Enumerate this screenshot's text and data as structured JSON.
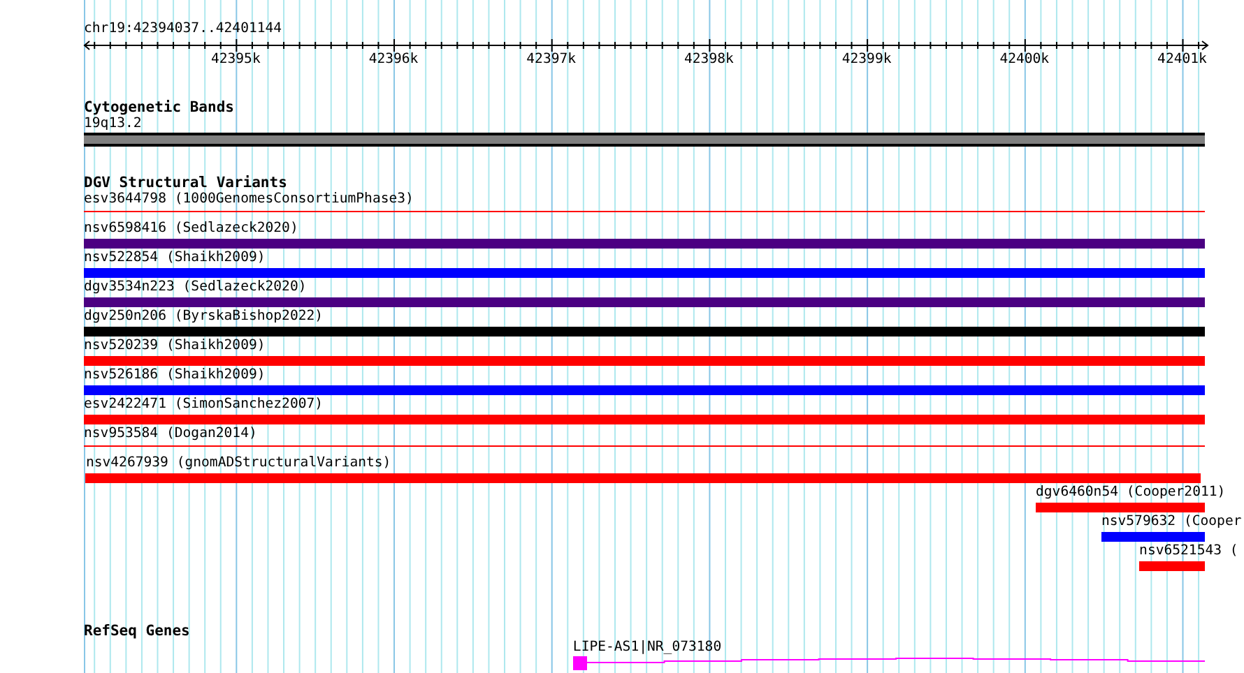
{
  "region": {
    "label": "chr19:42394037..42401144"
  },
  "ruler": {
    "ticks": [
      {
        "label": "42395k"
      },
      {
        "label": "42396k"
      },
      {
        "label": "42397k"
      },
      {
        "label": "42398k"
      },
      {
        "label": "42399k"
      },
      {
        "label": "42400k"
      },
      {
        "label": "42401k"
      }
    ]
  },
  "tracks": [
    {
      "kind": "cytoband",
      "title": "Cytogenetic Bands",
      "features": [
        {
          "label": "19q13.2",
          "color": "#808080"
        }
      ]
    },
    {
      "kind": "variants",
      "title": "DGV Structural Variants",
      "features": [
        {
          "label": "esv3644798 (1000GenomesConsortiumPhase3)",
          "kind": "thin",
          "color": "#ff0000"
        },
        {
          "label": "nsv6598416 (Sedlazeck2020)",
          "kind": "bar",
          "color": "#4b0082"
        },
        {
          "label": "nsv522854 (Shaikh2009)",
          "kind": "bar",
          "color": "#0000ff"
        },
        {
          "label": "dgv3534n223 (Sedlazeck2020)",
          "kind": "bar",
          "color": "#4b0082"
        },
        {
          "label": "dgv250n206 (ByrskaBishop2022)",
          "kind": "bar",
          "color": "#000000"
        },
        {
          "label": "nsv520239 (Shaikh2009)",
          "kind": "bar",
          "color": "#ff0000"
        },
        {
          "label": "nsv526186 (Shaikh2009)",
          "kind": "bar",
          "color": "#0000ff"
        },
        {
          "label": "esv2422471 (SimonSanchez2007)",
          "kind": "bar",
          "color": "#ff0000"
        },
        {
          "label": "nsv953584 (Dogan2014)",
          "kind": "thin",
          "color": "#ff0000"
        },
        {
          "label": "nsv4267939 (gnomADStructuralVariants)",
          "kind": "bar",
          "color": "#ff0000"
        },
        {
          "label": "dgv6460n54 (Cooper2011)",
          "kind": "bar",
          "color": "#ff0000"
        },
        {
          "label": "nsv579632 (Cooper",
          "kind": "bar",
          "color": "#0000ff"
        },
        {
          "label": "nsv6521543 (",
          "kind": "bar",
          "color": "#ff0000"
        }
      ]
    },
    {
      "kind": "genes",
      "title": "RefSeq Genes",
      "features": [
        {
          "label": "LIPE-AS1|NR_073180",
          "color": "#ff00ff"
        }
      ]
    }
  ]
}
